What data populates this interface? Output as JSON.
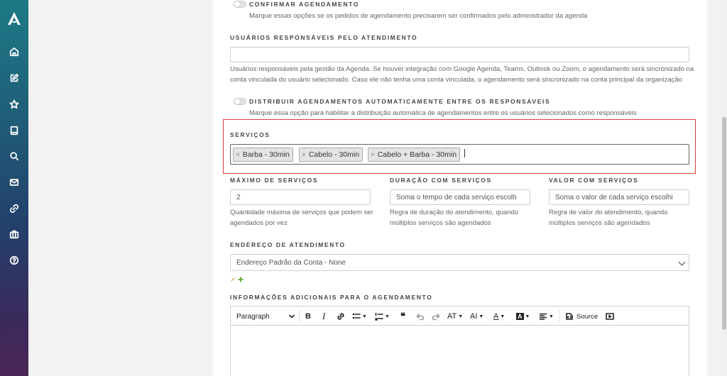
{
  "confirm": {
    "label": "CONFIRMAR AGENDAMENTO",
    "help": "Marque essas opções se os pedidos de agendamento precisarem ser confirmados pelo administrador da agenda"
  },
  "responsible": {
    "label": "USUÁRIOS RESPONSÁVEIS PELO ATENDIMENTO",
    "value": "",
    "help_line1": "Usuários responsáveis pela gestão da Agenda. Se houver integração com Google Agenda, Teams, Outlook ou Zoom, o agendamento será sincronizado na",
    "help_line2": "conta vinculada do usuário selecionado. Caso ele não tenha uma conta vinculada, o agendamento será sincronizado na conta principal da organização"
  },
  "distribute": {
    "label": "DISTRIBUIR AGENDAMENTOS AUTOMATICAMENTE ENTRE OS RESPONSAVEIS",
    "help": "Marque essa opção para habilitar a distribuição automática de agendamentos entre os usuários selecionados como responsáveis"
  },
  "services": {
    "label": "SERVIÇOS",
    "tags": [
      "Barba - 30min",
      "Cabelo - 30min",
      "Cabelo + Barba - 30min"
    ],
    "remove_glyph": "×"
  },
  "max_services": {
    "label": "MÁXIMO DE SERVIÇOS",
    "value": "2",
    "help_line1": "Quantidade máxima de serviços que podem ser",
    "help_line2": "agendados por vez"
  },
  "duration": {
    "label": "DURAÇÃO COM SERVIÇOS",
    "value": "Soma o tempo de cada serviço escolh",
    "help_line1": "Regra de duração do atendimento, quando",
    "help_line2": "múltiplos serviços são agendados"
  },
  "price": {
    "label": "VALOR COM SERVIÇOS",
    "value": "Soma o valor de cada serviço escolhi",
    "help_line1": "Regra de valor do atendimento, quando",
    "help_line2": "múltiplos serviços são agendados"
  },
  "address": {
    "label": "ENDEREÇO DE ATENDIMENTO",
    "value": "Endereço Padrão da Conta - None"
  },
  "extra_info": {
    "label": "INFORMAÇÕES ADICIONAIS PARA O AGENDAMENTO"
  },
  "editor": {
    "paragraph": "Paragraph",
    "source": "Source",
    "bold": "B",
    "italic": "I",
    "quote": "❝",
    "font_size": "AT",
    "font_family": "AI",
    "font_color": "A",
    "bg_color": "A"
  },
  "colors": {
    "highlight": "#e03b3b",
    "add_icon": "#6cb33f",
    "edit_icon": "#e8c58a"
  },
  "sidebar": {
    "icons": [
      "logo-icon",
      "home-icon",
      "edit-icon",
      "star-icon",
      "book-icon",
      "search-icon",
      "mail-icon",
      "link-icon",
      "briefcase-icon",
      "help-icon"
    ]
  }
}
